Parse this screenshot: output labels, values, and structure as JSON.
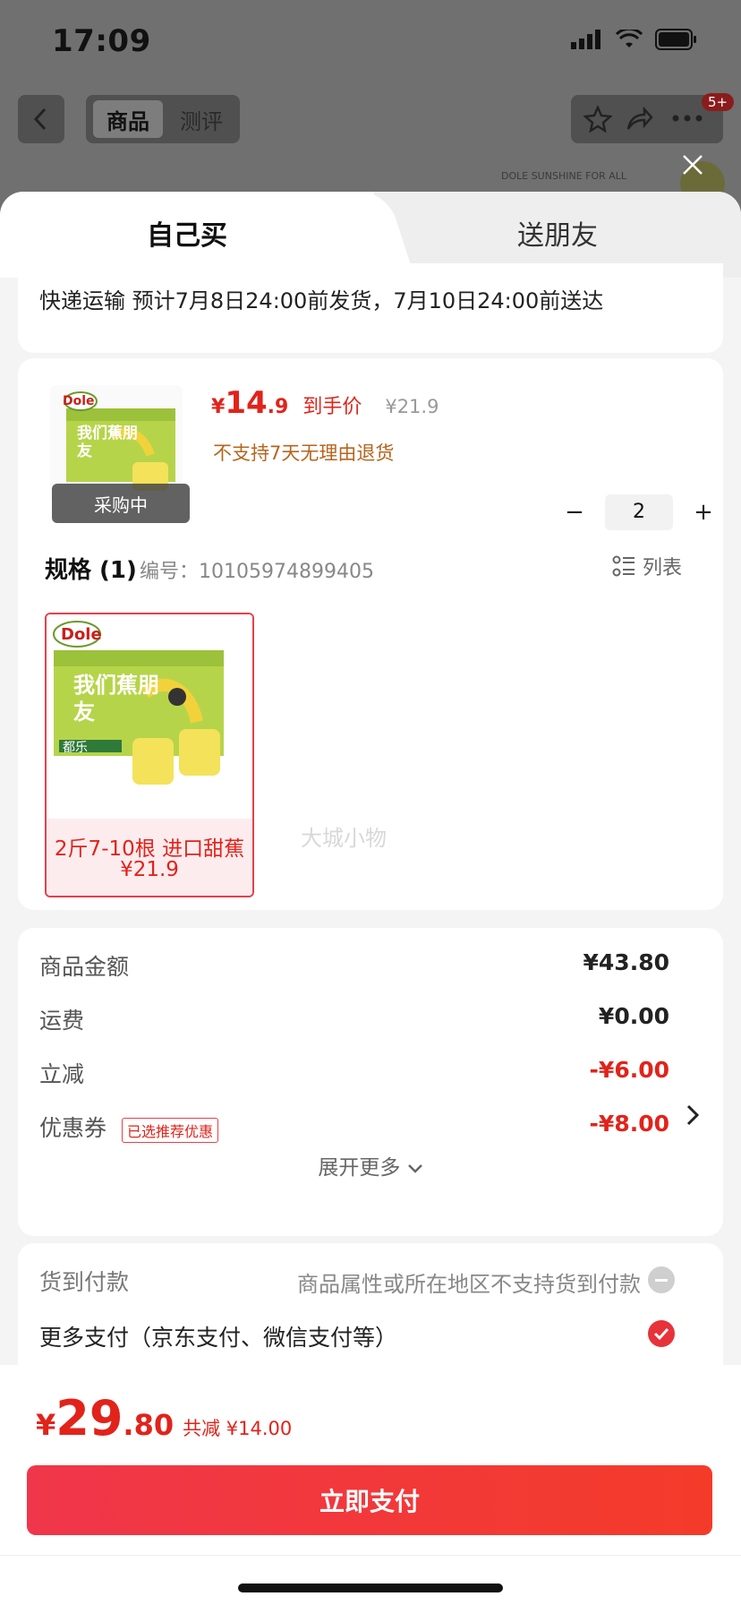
{
  "status_bar": {
    "time": "17:09"
  },
  "nav": {
    "tab_goods": "商品",
    "tab_review": "测评",
    "badge": "5+"
  },
  "background": {
    "banner_text": "DOLE SUNSHINE FOR ALL"
  },
  "tabs": {
    "self_buy": "自己买",
    "gift_friend": "送朋友"
  },
  "shipping": {
    "text": "快递运输 预计7月8日24:00前发货，7月10日24:00前送达"
  },
  "product": {
    "price_symbol": "¥",
    "price_int": "14",
    "price_dec": ".9",
    "price_label": "到手价",
    "original_price": "¥21.9",
    "return_policy": "不支持7天无理由退货",
    "overlay": "采购中",
    "quantity": "2",
    "minus": "−",
    "plus": "+",
    "spec_title": "规格 (1)",
    "spec_no": "编号：10105974899405",
    "list_label": "列表",
    "spec_option": {
      "name": "2斤7-10根 进口甜蕉",
      "price": "¥21.9"
    },
    "watermark": "大城小物",
    "pack_title": "我们蕉朋友",
    "brand": "Dole",
    "brand_cn": "都乐"
  },
  "summary": {
    "rows": [
      {
        "label": "商品金额",
        "value": "¥43.80"
      },
      {
        "label": "运费",
        "value": "¥0.00"
      },
      {
        "label": "立减",
        "value": "-¥6.00"
      },
      {
        "label": "优惠券",
        "value": "-¥8.00"
      }
    ],
    "coupon_tag": "已选推荐优惠",
    "expand": "展开更多"
  },
  "payment": {
    "cod_label": "货到付款",
    "cod_note": "商品属性或所在地区不支持货到付款",
    "more_label": "更多支付（京东支付、微信支付等）"
  },
  "bottom": {
    "yen": "¥",
    "total_int": "29",
    "total_dec": ".80",
    "save_text": "共减 ¥14.00",
    "pay_button": "立即支付"
  },
  "colors": {
    "accent_red": "#e2231a",
    "pay_gradient_start": "#f0364a",
    "pay_gradient_end": "#f43b2a"
  }
}
